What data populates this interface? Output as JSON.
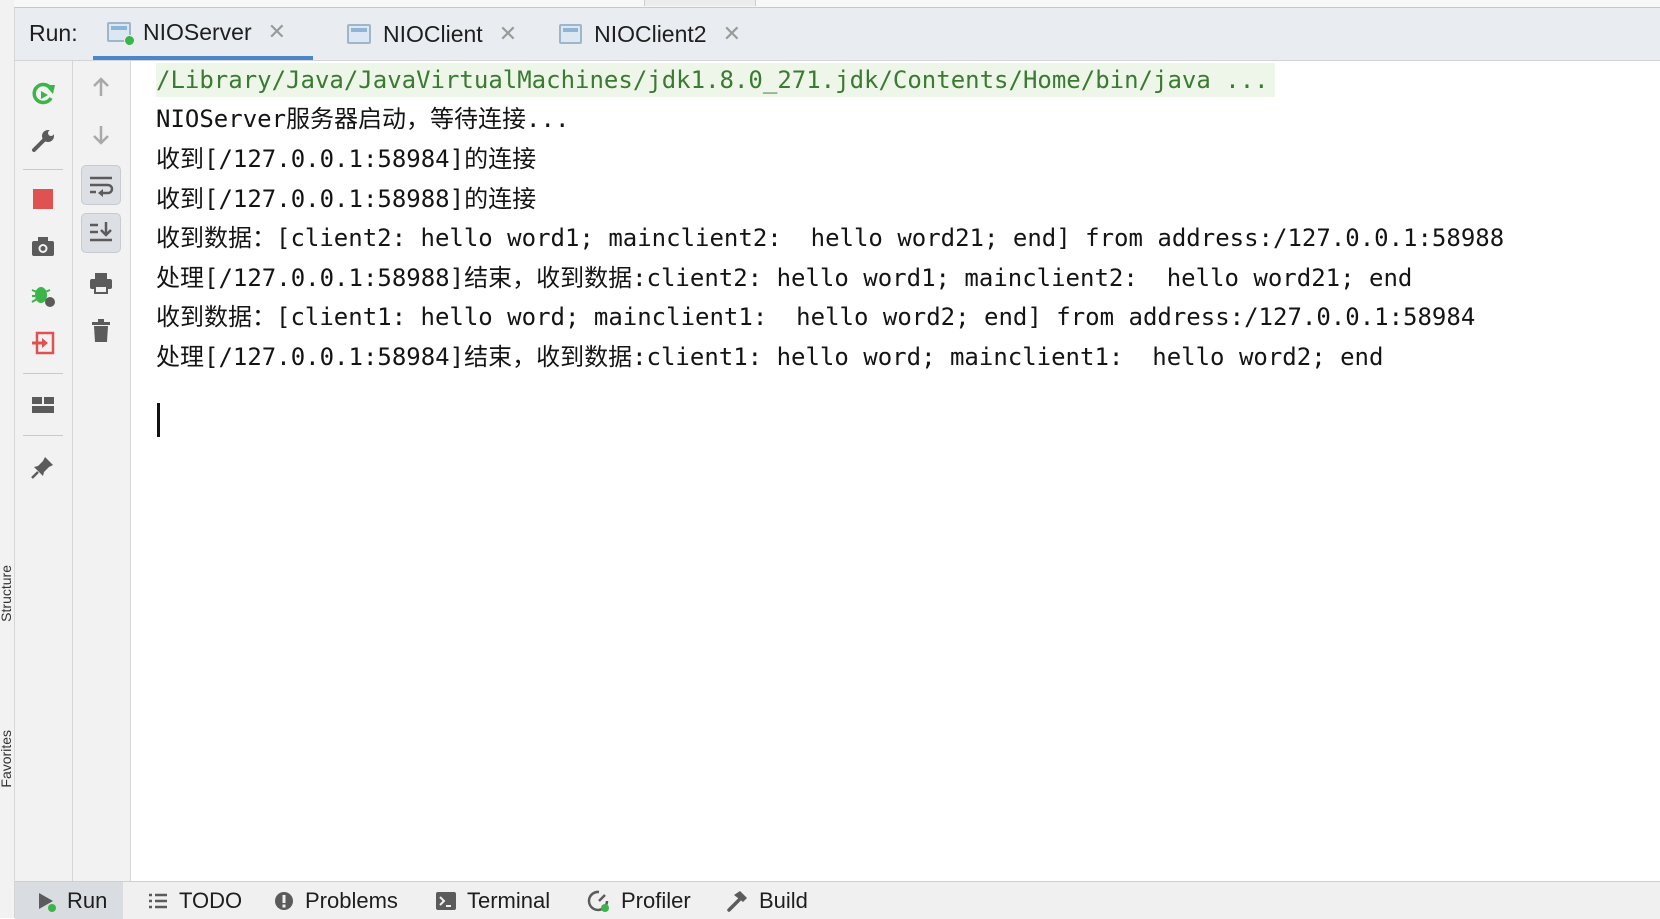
{
  "run_panel": {
    "title": "Run:",
    "tabs": [
      {
        "label": "NIOServer",
        "active": true
      },
      {
        "label": "NIOClient",
        "active": false
      },
      {
        "label": "NIOClient2",
        "active": false
      }
    ]
  },
  "left_strip": {
    "labels": [
      "Structure",
      "Favorites"
    ]
  },
  "console": {
    "lines": [
      "/Library/Java/JavaVirtualMachines/jdk1.8.0_271.jdk/Contents/Home/bin/java ...",
      "NIOServer服务器启动，等待连接...",
      "收到[/127.0.0.1:58984]的连接",
      "收到[/127.0.0.1:58988]的连接",
      "收到数据：[client2: hello word1; mainclient2:  hello word21; end] from address:/127.0.0.1:58988",
      "处理[/127.0.0.1:58988]结束，收到数据:client2: hello word1; mainclient2:  hello word21; end",
      "收到数据：[client1: hello word; mainclient1:  hello word2; end] from address:/127.0.0.1:58984",
      "处理[/127.0.0.1:58984]结束，收到数据:client1: hello word; mainclient1:  hello word2; end"
    ]
  },
  "bottom_bar": {
    "tabs": [
      {
        "label": "Run",
        "icon": "play-icon",
        "active": true
      },
      {
        "label": "TODO",
        "icon": "list-icon",
        "active": false
      },
      {
        "label": "Problems",
        "icon": "warning-icon",
        "active": false
      },
      {
        "label": "Terminal",
        "icon": "terminal-icon",
        "active": false
      },
      {
        "label": "Profiler",
        "icon": "profiler-icon",
        "active": false
      },
      {
        "label": "Build",
        "icon": "hammer-icon",
        "active": false
      }
    ]
  },
  "colors": {
    "accent": "#4a86c8",
    "command_text": "#3b7a32",
    "command_bg": "#edf6e8",
    "stop_red": "#e05252",
    "run_green": "#3bb54a"
  }
}
